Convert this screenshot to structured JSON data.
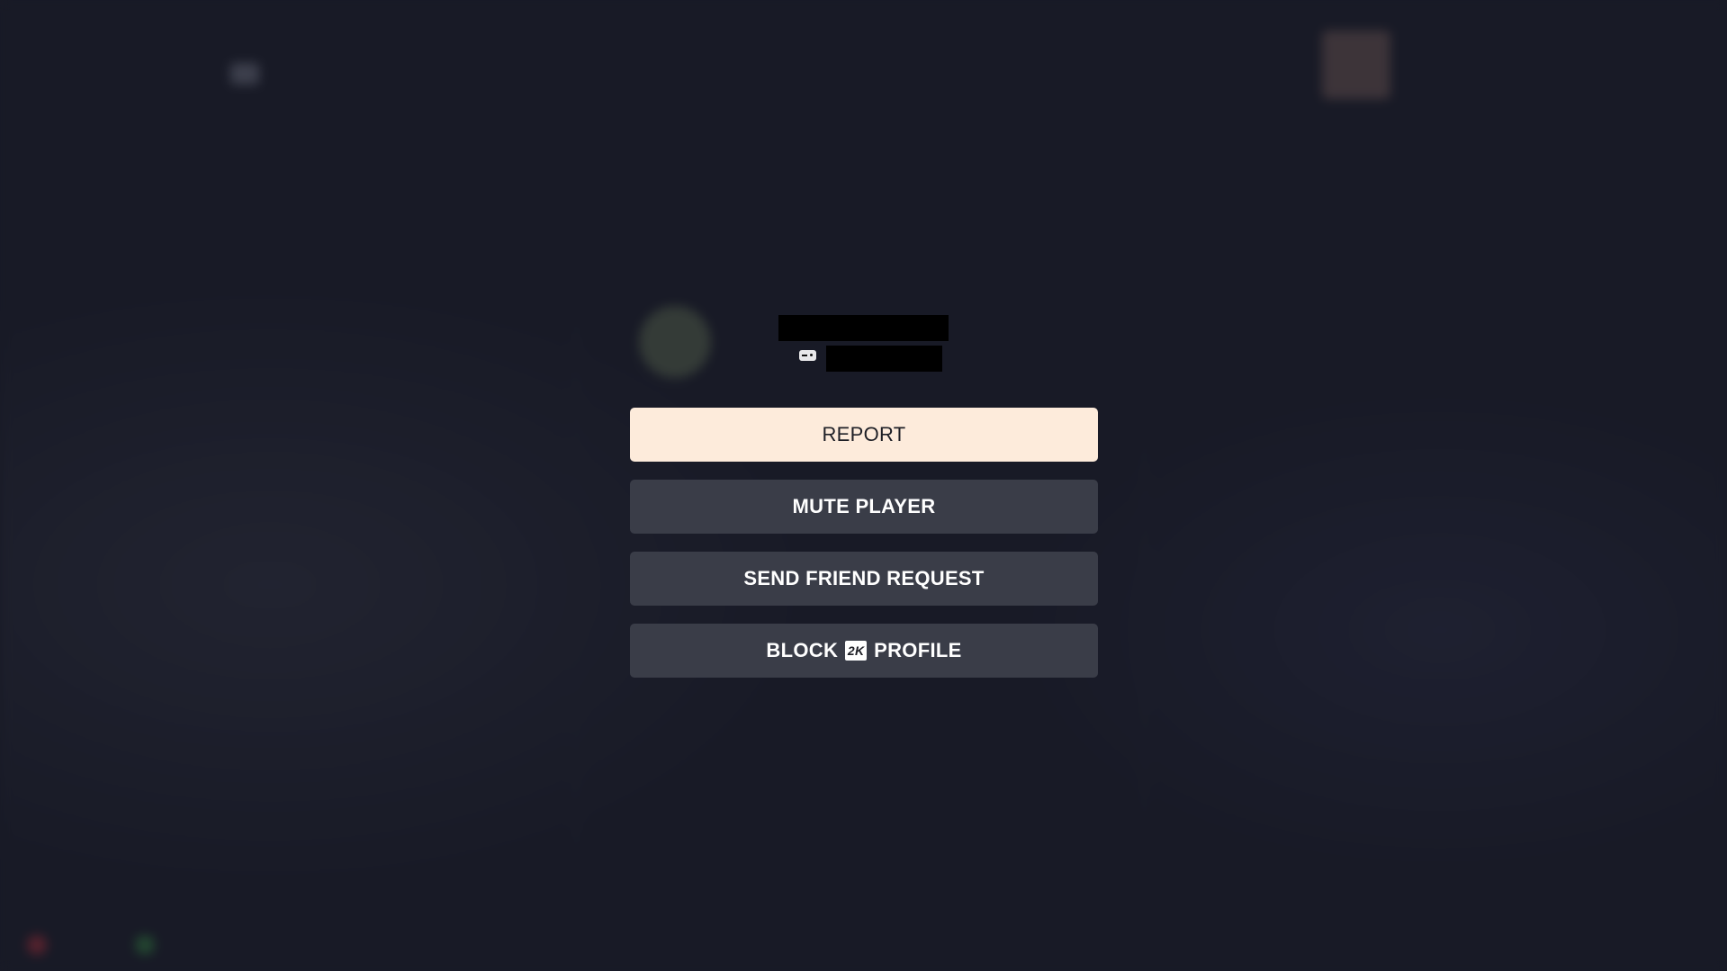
{
  "background": {
    "app_title": "",
    "nav": [
      "",
      "",
      "",
      "",
      "",
      "",
      ""
    ],
    "columns": {
      "left": "",
      "center": "",
      "right": ""
    },
    "friends_empty": "",
    "hints": [
      {
        "label": "",
        "color": "#8a2a35"
      },
      {
        "label": "",
        "color": "#2d6b3a"
      }
    ]
  },
  "player": {
    "name_redacted": true,
    "id_redacted": true,
    "platform_icon": "gamepad-icon"
  },
  "menu": {
    "items": [
      {
        "label": "REPORT",
        "selected": true
      },
      {
        "label": "MUTE PLAYER",
        "selected": false
      },
      {
        "label": "SEND FRIEND REQUEST",
        "selected": false
      },
      {
        "label_prefix": "BLOCK",
        "badge": "2K",
        "label_suffix": "PROFILE",
        "selected": false
      }
    ]
  },
  "colors": {
    "selected_button": "#fdebdb",
    "button": "#3a3d48",
    "background": "#181a26"
  }
}
